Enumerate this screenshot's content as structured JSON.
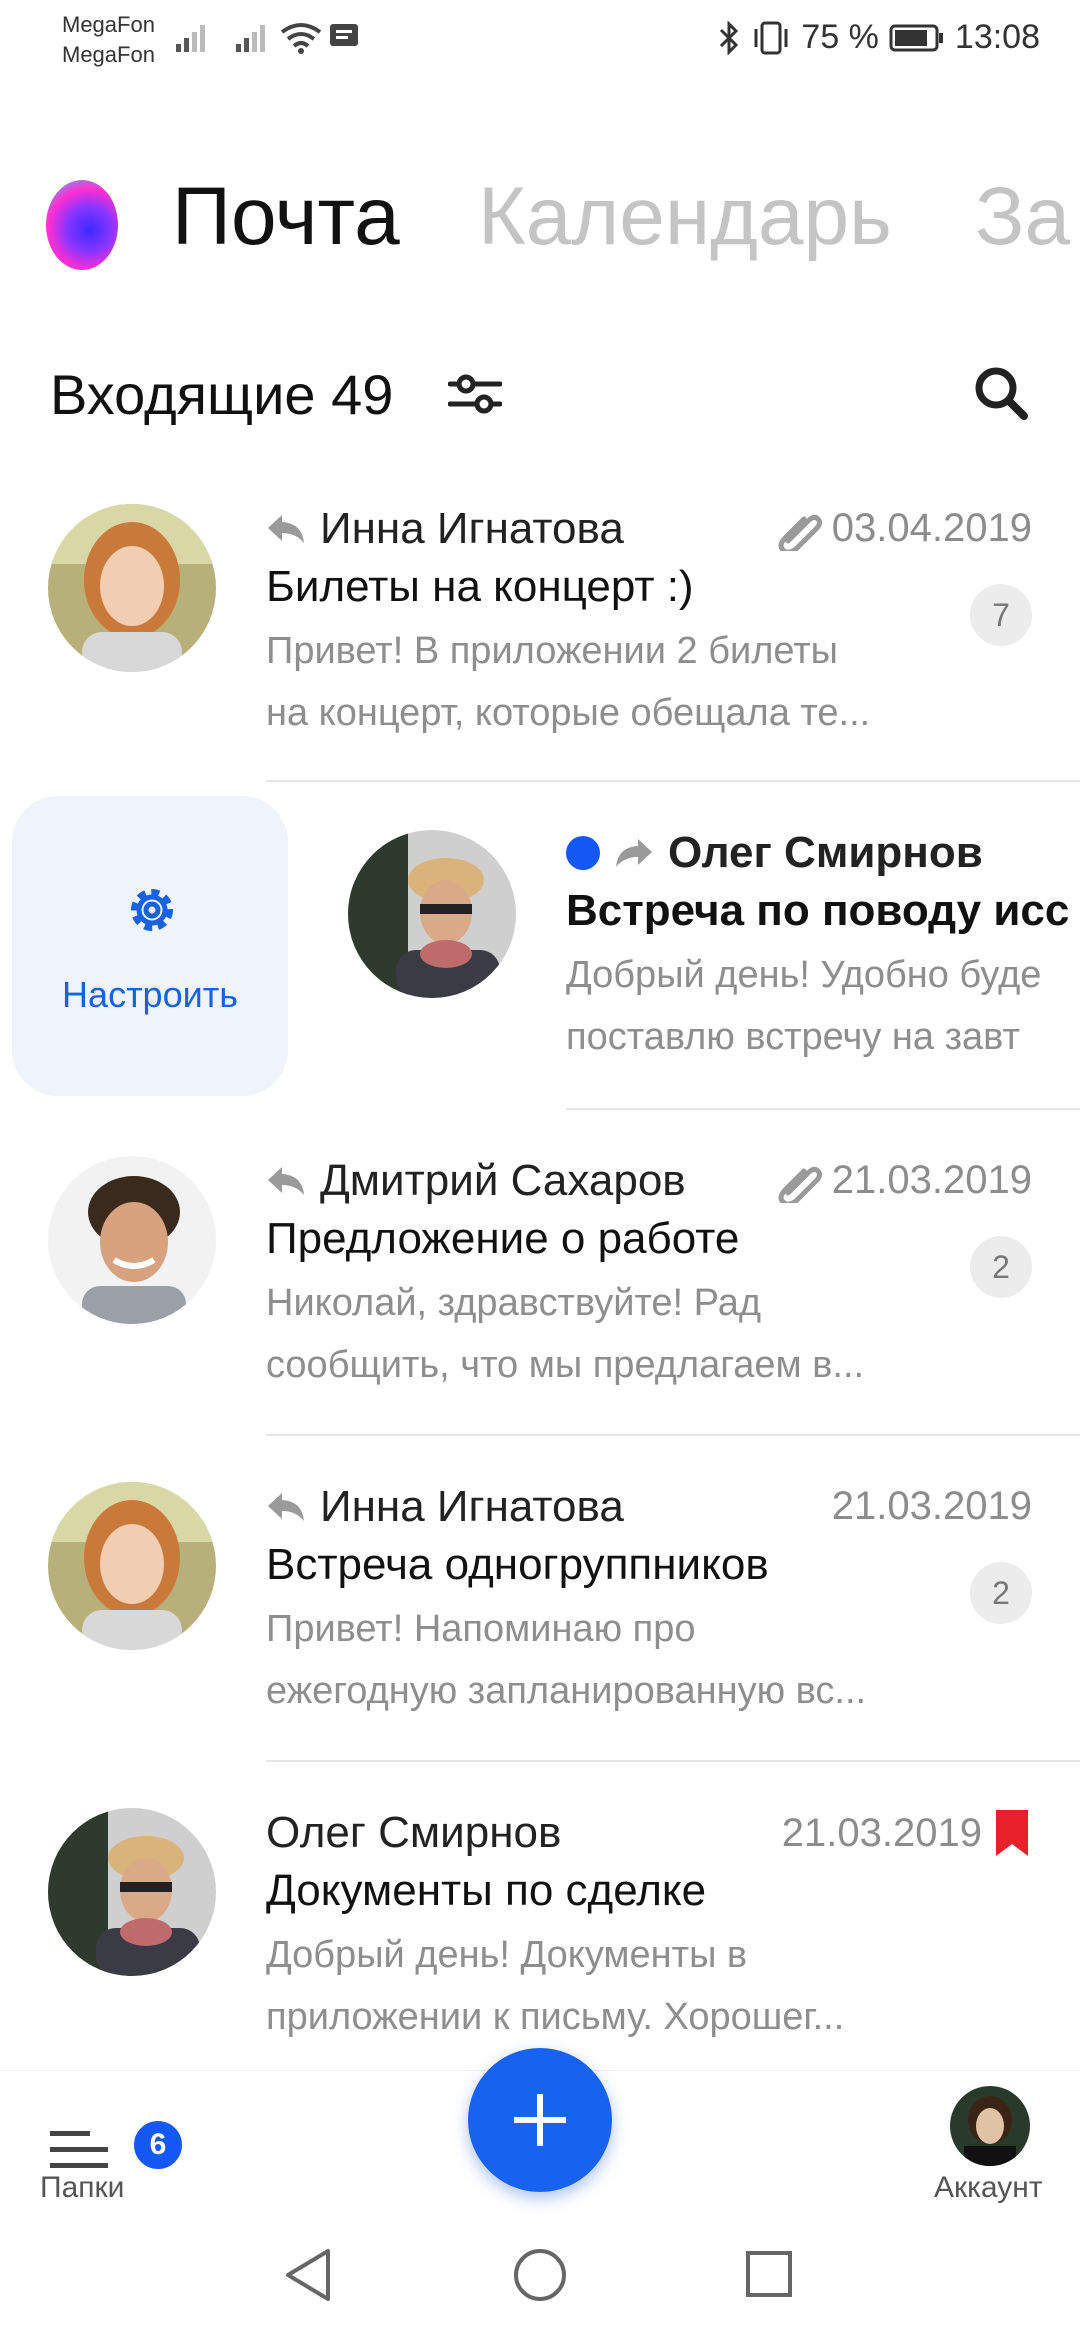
{
  "status_bar": {
    "carrier1": "MegaFon",
    "carrier2": "MegaFon",
    "battery": "75 %",
    "time": "13:08"
  },
  "tabs": [
    {
      "label": "Почта"
    },
    {
      "label": "Календарь"
    },
    {
      "label": "За"
    }
  ],
  "inbox": {
    "title": "Входящие",
    "count": "49"
  },
  "swipe_action": {
    "label": "Настроить"
  },
  "emails": [
    {
      "sender": "Инна Игнатова",
      "date": "03.04.2019",
      "subject": "Билеты на концерт :)",
      "preview1": "Привет! В приложении 2 билеты",
      "preview2": "на концерт, которые обещала те...",
      "thread_count": "7",
      "status_icon": "reply-icon",
      "has_attachment": true
    },
    {
      "sender": "Олег Смирнов",
      "subject": "Встреча по поводу исс",
      "preview1": "Добрый день! Удобно буде",
      "preview2": "поставлю встречу на завт",
      "status_icon": "forward-icon",
      "unread": true
    },
    {
      "sender": "Дмитрий Сахаров",
      "date": "21.03.2019",
      "subject": "Предложение о работе",
      "preview1": "Николай, здравствуйте! Рад",
      "preview2": "сообщить, что мы предлагаем в...",
      "thread_count": "2",
      "status_icon": "reply-icon",
      "has_attachment": true
    },
    {
      "sender": "Инна Игнатова",
      "date": "21.03.2019",
      "subject": "Встреча одногруппников",
      "preview1": "Привет! Напоминаю про",
      "preview2": "ежегодную запланированную вс...",
      "thread_count": "2",
      "status_icon": "reply-icon"
    },
    {
      "sender": "Олег Смирнов",
      "date": "21.03.2019",
      "subject": "Документы по сделке",
      "preview1": "Добрый день! Документы в",
      "preview2": "приложении к письму. Хорошег...",
      "flagged": true
    }
  ],
  "bottom_nav": {
    "folders_label": "Папки",
    "folders_badge": "6",
    "account_label": "Аккаунт"
  },
  "colors": {
    "accent": "#1763f0",
    "unread_dot": "#1459f5",
    "flag": "#e8202a",
    "secondary_text": "#8e8e8e"
  }
}
